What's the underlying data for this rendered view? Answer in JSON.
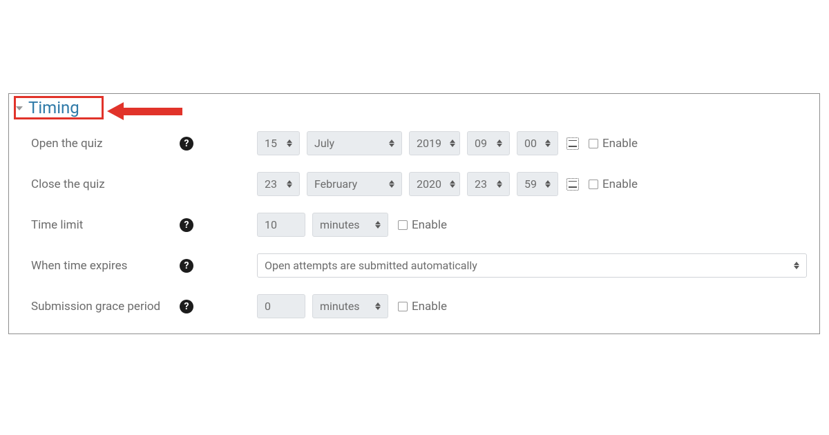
{
  "section": {
    "title": "Timing"
  },
  "rows": {
    "open": {
      "label": "Open the quiz",
      "day": "15",
      "month": "July",
      "year": "2019",
      "hour": "09",
      "minute": "00",
      "enable": "Enable"
    },
    "close": {
      "label": "Close the quiz",
      "day": "23",
      "month": "February",
      "year": "2020",
      "hour": "23",
      "minute": "59",
      "enable": "Enable"
    },
    "limit": {
      "label": "Time limit",
      "value": "10",
      "unit": "minutes",
      "enable": "Enable"
    },
    "expire": {
      "label": "When time expires",
      "value": "Open attempts are submitted automatically"
    },
    "grace": {
      "label": "Submission grace period",
      "value": "0",
      "unit": "minutes",
      "enable": "Enable"
    }
  },
  "annotation": {
    "highlight_color": "#e1332a"
  }
}
